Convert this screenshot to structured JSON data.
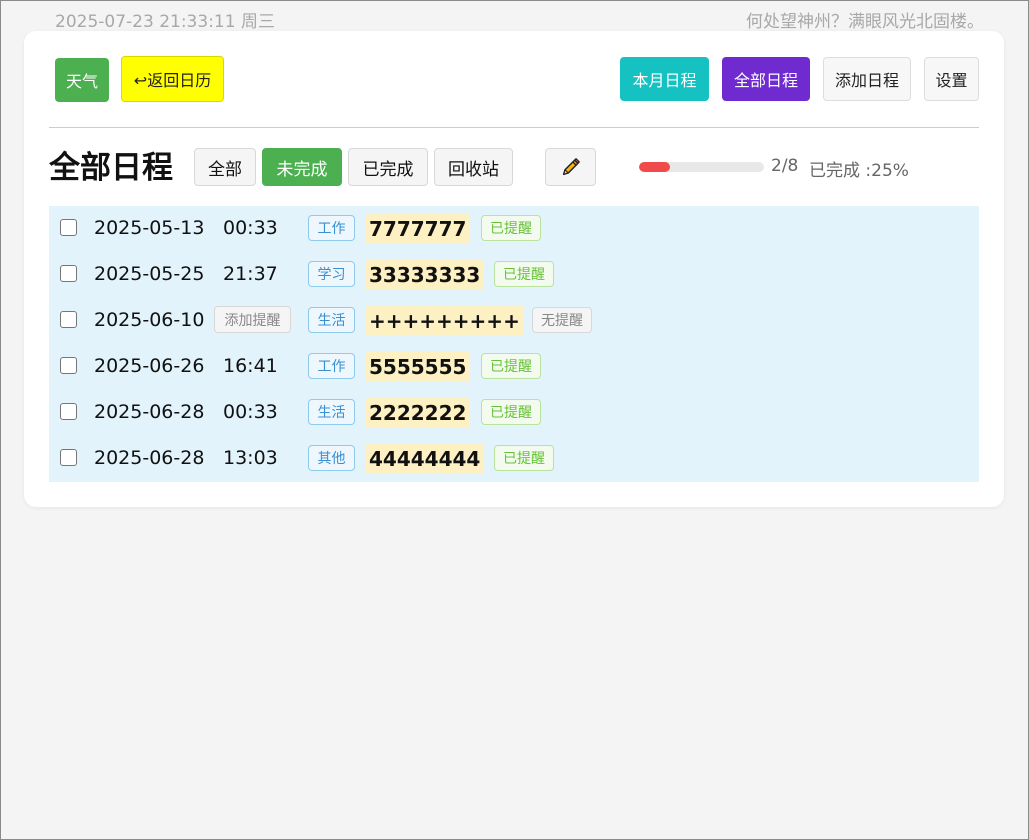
{
  "topbar": {
    "datetime": "2025-07-23 21:33:11 周三",
    "quote": "何处望神州？满眼风光北固楼。"
  },
  "toolbar": {
    "weather_label": "天气",
    "back_label": "↩返回日历",
    "month_label": "本月日程",
    "all_label": "全部日程",
    "add_label": "添加日程",
    "settings_label": "设置"
  },
  "section": {
    "title": "全部日程",
    "filters": [
      "全部",
      "未完成",
      "已完成",
      "回收站"
    ],
    "active_filter": "未完成",
    "edit_icon": "pencil-icon"
  },
  "progress": {
    "completed": 2,
    "total": 8,
    "count_text": "2/8",
    "label": "已完成 :25%",
    "fraction": 0.25
  },
  "schedules": [
    {
      "date": "2025-05-13",
      "time": "00:33",
      "tag": "工作",
      "title": "7777777",
      "remind": "已提醒",
      "remind_on": true
    },
    {
      "date": "2025-05-25",
      "time": "21:37",
      "tag": "学习",
      "title": "33333333",
      "remind": "已提醒",
      "remind_on": true
    },
    {
      "date": "2025-06-10",
      "time": "",
      "add_remind": "添加提醒",
      "tag": "生活",
      "title": "+++++++++",
      "remind": "无提醒",
      "remind_on": false
    },
    {
      "date": "2025-06-26",
      "time": "16:41",
      "tag": "工作",
      "title": "5555555",
      "remind": "已提醒",
      "remind_on": true
    },
    {
      "date": "2025-06-28",
      "time": "00:33",
      "tag": "生活",
      "title": "2222222",
      "remind": "已提醒",
      "remind_on": true
    },
    {
      "date": "2025-06-28",
      "time": "13:03",
      "tag": "其他",
      "title": "44444444",
      "remind": "已提醒",
      "remind_on": true
    }
  ],
  "colors": {
    "weather": "#4caf50",
    "back": "#ffff00",
    "month": "#16c1c1",
    "all": "#6f2bd0",
    "filter_active": "#4caf50",
    "progress": "#f04a4a",
    "list_bg": "#e2f3fc",
    "title_highlight": "#fdf0c2"
  }
}
